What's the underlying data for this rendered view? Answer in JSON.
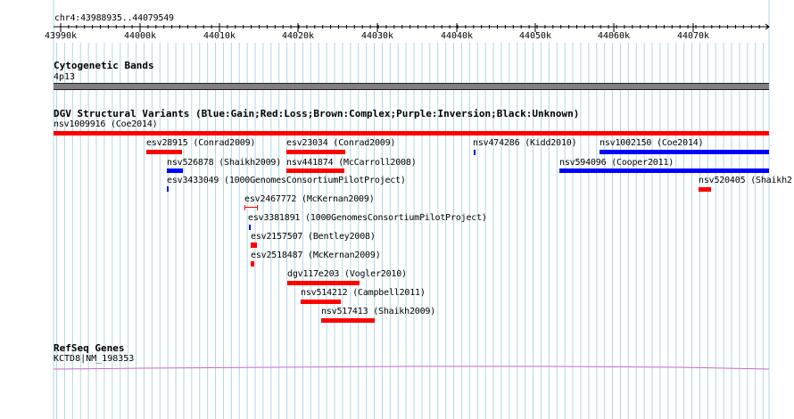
{
  "region": "chr4:43988935..44079549",
  "ruler": {
    "ticks": [
      "43990k",
      "44000k",
      "44010k",
      "44020k",
      "44030k",
      "44040k",
      "44050k",
      "44060k",
      "44070k"
    ]
  },
  "cytoband": {
    "title": "Cytogenetic Bands",
    "band": "4p13"
  },
  "dgv": {
    "title": "DGV Structural Variants (Blue:Gain;Red:Loss;Brown:Complex;Purple:Inversion;Black:Unknown)",
    "features": [
      {
        "label": "nsv1009916 (Coe2014)",
        "color": "red"
      },
      {
        "label": "esv28915 (Conrad2009)",
        "color": "red"
      },
      {
        "label": "esv23034 (Conrad2009)",
        "color": "red"
      },
      {
        "label": "nsv474286 (Kidd2010)",
        "color": "blue"
      },
      {
        "label": "nsv1002150 (Coe2014)",
        "color": "blue"
      },
      {
        "label": "nsv526878 (Shaikh2009)",
        "color": "blue"
      },
      {
        "label": "nsv441874 (McCarroll2008)",
        "color": "red"
      },
      {
        "label": "nsv594096 (Cooper2011)",
        "color": "blue"
      },
      {
        "label": "esv3433049 (1000GenomesConsortiumPilotProject)",
        "color": "blue"
      },
      {
        "label": "nsv520405 (Shaikh2",
        "color": "red"
      },
      {
        "label": "esv2467772 (McKernan2009)",
        "color": "red"
      },
      {
        "label": "esv3381891 (1000GenomesConsortiumPilotProject)",
        "color": "blue"
      },
      {
        "label": "esv2157507 (Bentley2008)",
        "color": "red"
      },
      {
        "label": "esv2518487 (McKernan2009)",
        "color": "red"
      },
      {
        "label": "dgv117e203 (Vogler2010)",
        "color": "red"
      },
      {
        "label": "nsv514212 (Campbell2011)",
        "color": "red"
      },
      {
        "label": "nsv517413 (Shaikh2009)",
        "color": "red"
      }
    ]
  },
  "refseq": {
    "title": "RefSeq Genes",
    "gene": "KCTD8|NM_198353"
  },
  "colors": {
    "gain": "#0000ff",
    "loss": "#ff0000",
    "grid": "#add8e6",
    "gene": "#cc66cc",
    "band": "#808080"
  }
}
